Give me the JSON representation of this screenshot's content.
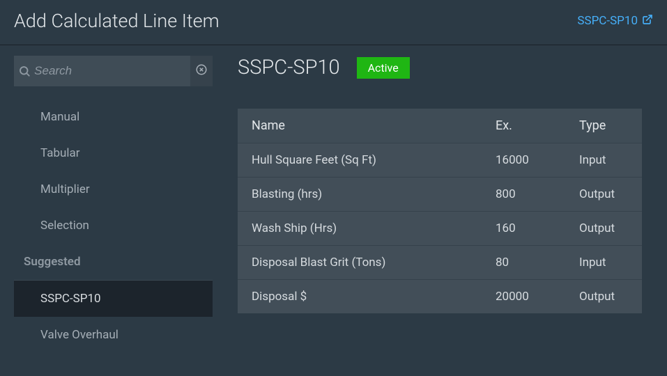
{
  "header": {
    "title": "Add Calculated Line Item",
    "link_label": "SSPC-SP10"
  },
  "search": {
    "placeholder": "Search"
  },
  "sidebar": {
    "items": [
      {
        "label": "Manual",
        "type": "item"
      },
      {
        "label": "Tabular",
        "type": "item"
      },
      {
        "label": "Multiplier",
        "type": "item"
      },
      {
        "label": "Selection",
        "type": "item"
      },
      {
        "label": "Suggested",
        "type": "category"
      },
      {
        "label": "SSPC-SP10",
        "type": "item",
        "selected": true
      },
      {
        "label": "Valve Overhaul",
        "type": "item"
      }
    ]
  },
  "main": {
    "title": "SSPC-SP10",
    "status": "Active",
    "columns": {
      "name": "Name",
      "ex": "Ex.",
      "type": "Type"
    },
    "rows": [
      {
        "name": "Hull Square Feet (Sq Ft)",
        "ex": "16000",
        "type": "Input"
      },
      {
        "name": "Blasting (hrs)",
        "ex": "800",
        "type": "Output"
      },
      {
        "name": "Wash Ship (Hrs)",
        "ex": "160",
        "type": "Output"
      },
      {
        "name": "Disposal Blast Grit (Tons)",
        "ex": "80",
        "type": "Input"
      },
      {
        "name": "Disposal $",
        "ex": "20000",
        "type": "Output"
      }
    ]
  }
}
